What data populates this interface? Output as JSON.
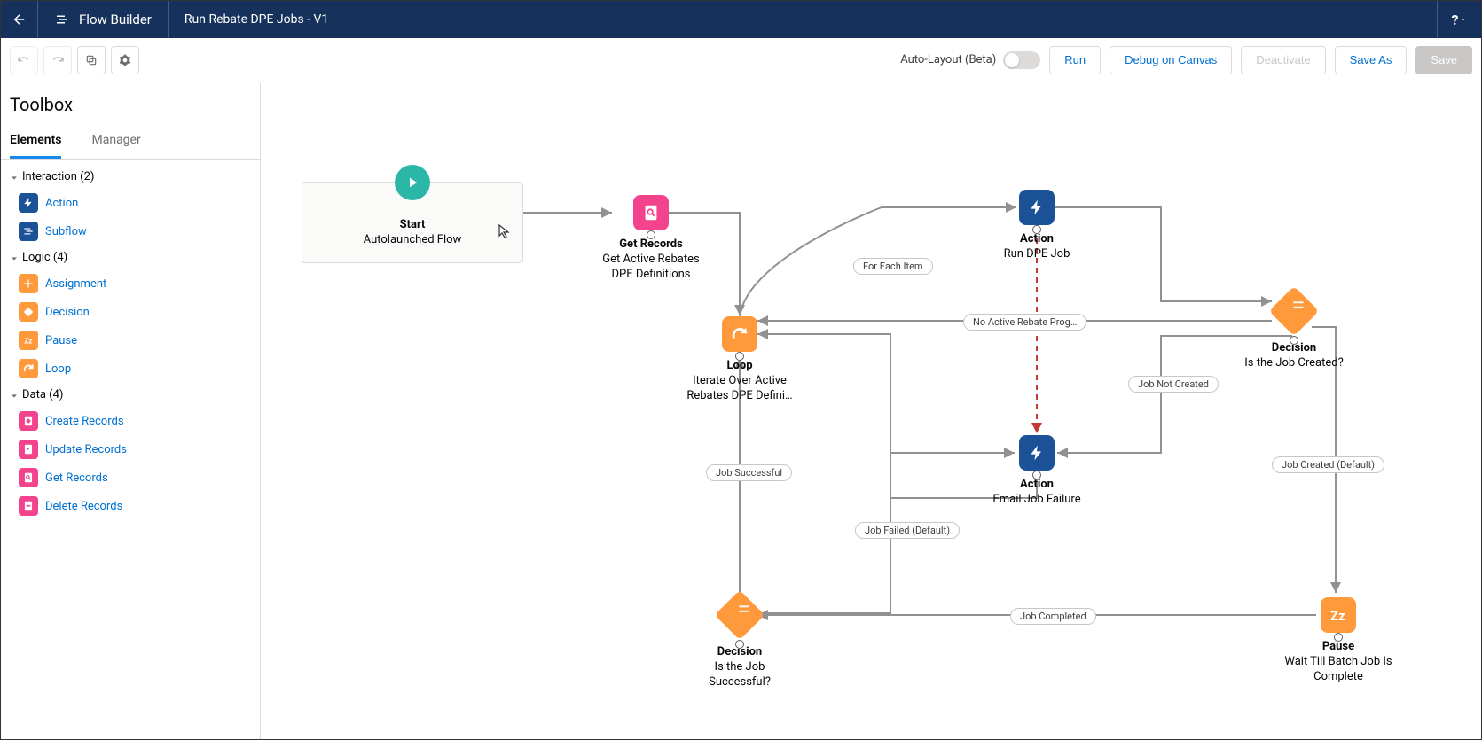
{
  "header": {
    "app_name": "Flow Builder",
    "flow_name": "Run Rebate DPE Jobs - V1",
    "help": "?"
  },
  "toolbar": {
    "auto_layout": "Auto-Layout (Beta)",
    "run": "Run",
    "debug": "Debug on Canvas",
    "deactivate": "Deactivate",
    "save_as": "Save As",
    "save": "Save"
  },
  "sidebar": {
    "title": "Toolbox",
    "tabs": {
      "elements": "Elements",
      "manager": "Manager"
    },
    "sections": {
      "interaction": "Interaction (2)",
      "logic": "Logic (4)",
      "data": "Data (4)"
    },
    "items": {
      "action": "Action",
      "subflow": "Subflow",
      "assignment": "Assignment",
      "decision": "Decision",
      "pause": "Pause",
      "loop": "Loop",
      "create_records": "Create Records",
      "update_records": "Update Records",
      "get_records": "Get Records",
      "delete_records": "Delete Records"
    }
  },
  "nodes": {
    "start": {
      "title": "Start",
      "sub": "Autolaunched Flow"
    },
    "get_records": {
      "title": "Get Records",
      "sub1": "Get Active Rebates",
      "sub2": "DPE Definitions"
    },
    "action1": {
      "title": "Action",
      "sub": "Run DPE Job"
    },
    "loop": {
      "title": "Loop",
      "sub1": "Iterate Over Active",
      "sub2": "Rebates DPE Defini…"
    },
    "decision1": {
      "title": "Decision",
      "sub": "Is the Job Created?"
    },
    "action2": {
      "title": "Action",
      "sub": "Email Job Failure"
    },
    "pause": {
      "title": "Pause",
      "sub1": "Wait Till Batch Job Is",
      "sub2": "Complete"
    },
    "decision2": {
      "title": "Decision",
      "sub1": "Is the Job",
      "sub2": "Successful?"
    }
  },
  "pills": {
    "for_each": "For Each Item",
    "no_active": "No Active Rebate Prog…",
    "job_not_created": "Job Not Created",
    "job_created": "Job Created (Default)",
    "job_completed": "Job Completed",
    "job_failed": "Job Failed (Default)",
    "job_successful": "Job Successful"
  }
}
